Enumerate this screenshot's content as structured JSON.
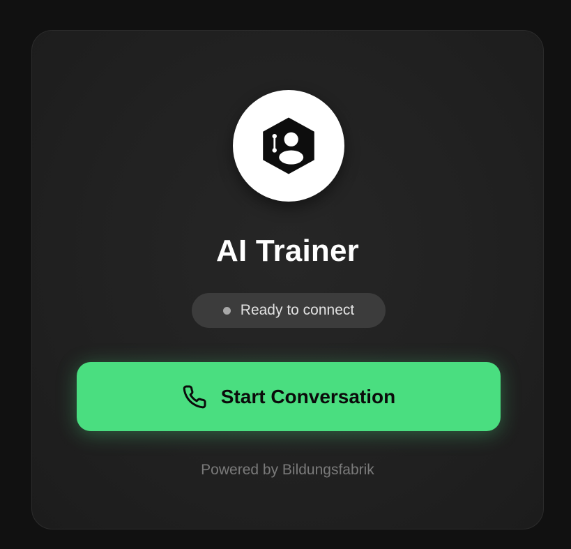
{
  "widget": {
    "avatar_icon": "hexagon-user-voice-icon",
    "title": "AI Trainer",
    "status_text": "Ready to connect",
    "status_dot_color": "#a8a8a8",
    "start_button_label": "Start Conversation",
    "start_button_icon": "phone-icon",
    "accent_color": "#4ade80",
    "footer_text": "Powered by Bildungsfabrik"
  }
}
